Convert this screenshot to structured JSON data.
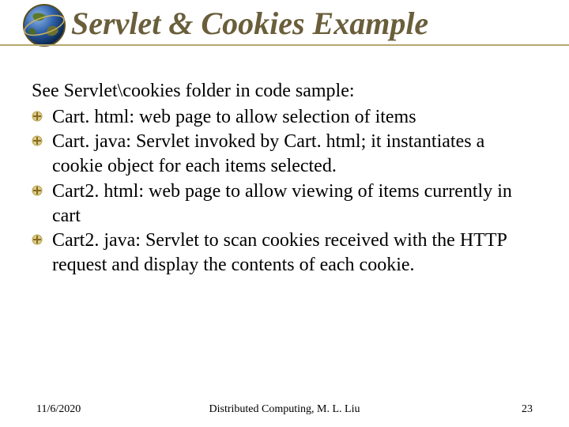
{
  "header": {
    "title": "Servlet & Cookies Example"
  },
  "content": {
    "intro": "See Servlet\\cookies folder in code sample:",
    "items": [
      "Cart. html: web page to allow selection of items",
      "Cart. java: Servlet invoked by Cart. html; it instantiates a cookie object for each items selected.",
      "Cart2. html: web page to allow viewing of items currently in cart",
      "Cart2. java: Servlet to scan cookies received with the HTTP request and display the contents of each cookie."
    ]
  },
  "footer": {
    "date": "11/6/2020",
    "center": "Distributed Computing, M. L. Liu",
    "page": "23"
  }
}
